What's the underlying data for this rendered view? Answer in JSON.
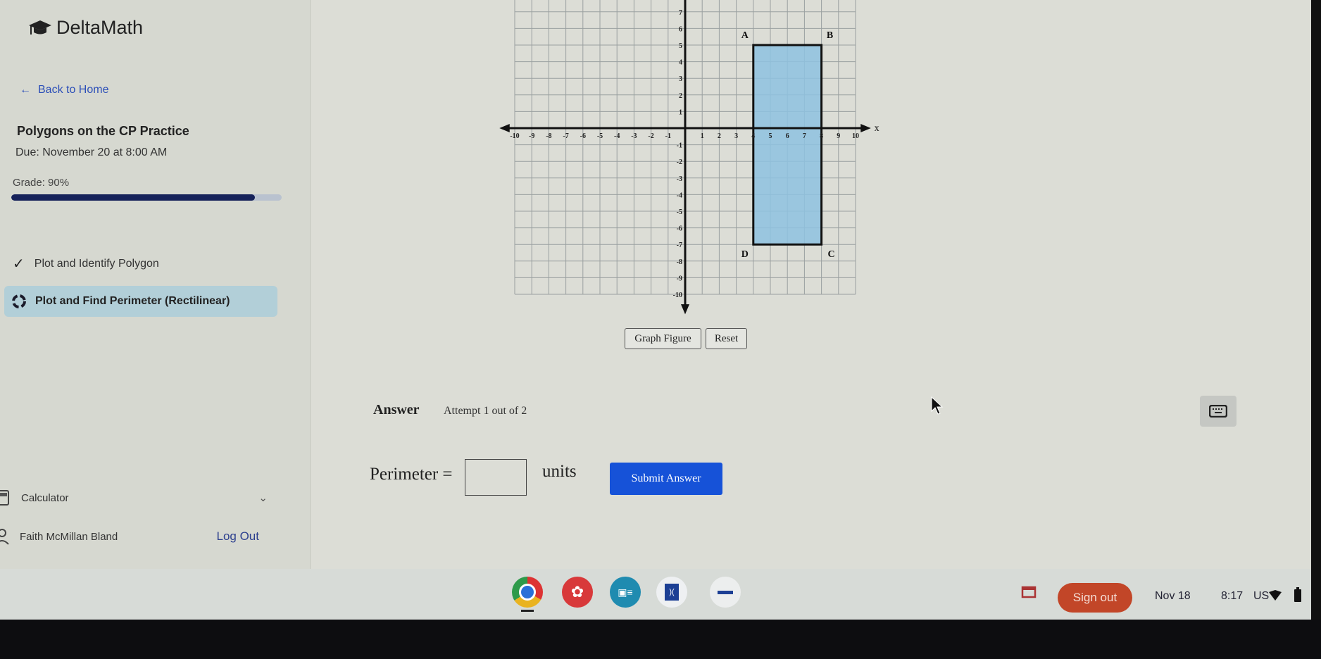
{
  "sidebar": {
    "logo_text": "DeltaMath",
    "back_label": "Back to Home",
    "assignment_title": "Polygons on the CP Practice",
    "due": "Due: November 20 at 8:00 AM",
    "grade_label": "Grade: 90%",
    "grade_percent": 90,
    "items": [
      {
        "label": "Plot and Identify Polygon",
        "status": "complete"
      },
      {
        "label": "Plot and Find Perimeter (Rectilinear)",
        "status": "in-progress",
        "active": true
      }
    ],
    "calculator_label": "Calculator",
    "user_name": "Faith McMillan Bland",
    "logout_label": "Log Out"
  },
  "graph": {
    "x_range": [
      -10,
      10
    ],
    "y_range": [
      -10,
      7
    ],
    "x_axis_label": "x",
    "x_ticks": [
      "-10",
      "-9",
      "-8",
      "-7",
      "-6",
      "-5",
      "-4",
      "-3",
      "-2",
      "-1",
      "1",
      "2",
      "3",
      "4",
      "5",
      "6",
      "7",
      "8",
      "9",
      "10"
    ],
    "y_ticks": [
      "7",
      "6",
      "5",
      "4",
      "3",
      "2",
      "1",
      "-1",
      "-2",
      "-3",
      "-4",
      "-5",
      "-6",
      "-7",
      "-8",
      "-9",
      "-10"
    ],
    "polygon": [
      {
        "label": "A",
        "x": 4,
        "y": 5
      },
      {
        "label": "B",
        "x": 8,
        "y": 5
      },
      {
        "label": "C",
        "x": 8,
        "y": -7
      },
      {
        "label": "D",
        "x": 4,
        "y": -7
      }
    ],
    "fill_color": "#8ec2e0",
    "graph_button": "Graph Figure",
    "reset_button": "Reset"
  },
  "answer": {
    "heading": "Answer",
    "attempt": "Attempt 1 out of 2",
    "prompt": "Perimeter =",
    "value": "",
    "units": "units",
    "submit_label": "Submit Answer",
    "submit_color": "#1652d8"
  },
  "taskbar": {
    "apps": [
      "chrome-icon",
      "paint-icon",
      "classroom-icon",
      "app-icon",
      "pearson-icon"
    ],
    "sign_out": "Sign out",
    "date": "Nov 18",
    "time": "8:17",
    "locale": "US"
  }
}
